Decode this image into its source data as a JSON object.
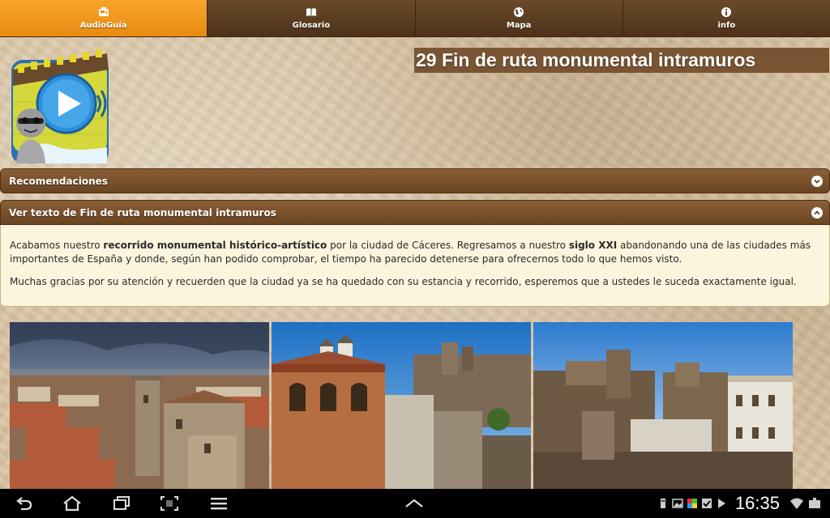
{
  "tabs": [
    {
      "label": "AudioGuía",
      "icon": "audioguide-icon",
      "active": true
    },
    {
      "label": "Glosario",
      "icon": "book-icon",
      "active": false
    },
    {
      "label": "Mapa",
      "icon": "globe-icon",
      "active": false
    },
    {
      "label": "info",
      "icon": "info-icon",
      "active": false
    }
  ],
  "title": "29 Fin de ruta monumental intramuros",
  "sections": {
    "recommendations": "Recomendaciones",
    "text_header": "Ver texto de Fin de ruta monumental intramuros"
  },
  "content": {
    "p1_a": "Acabamos nuestro ",
    "p1_b": "recorrido monumental histórico-artístico",
    "p1_c": " por la ciudad de Cáceres. Regresamos a nuestro ",
    "p1_d": "siglo XXI",
    "p1_e": " abandonando una de las ciudades más importantes de España y donde, según han podido comprobar, el tiempo ha parecido detenerse para ofrecernos todo lo que hemos visto.",
    "p2": "Muchas gracias por su atención y recuerden que la ciudad ya se ha quedado con su estancia y recorrido, esperemos que a ustedes le suceda exactamente igual."
  },
  "photos": [
    "city-panorama-photo",
    "tower-building-photo",
    "old-town-photo"
  ],
  "status": {
    "time": "16:35"
  },
  "colors": {
    "tab_active": "#f7a42b",
    "tab_bg": "#5a3d20",
    "header_bg": "#7a5230",
    "content_bg": "#fcf5dd"
  }
}
